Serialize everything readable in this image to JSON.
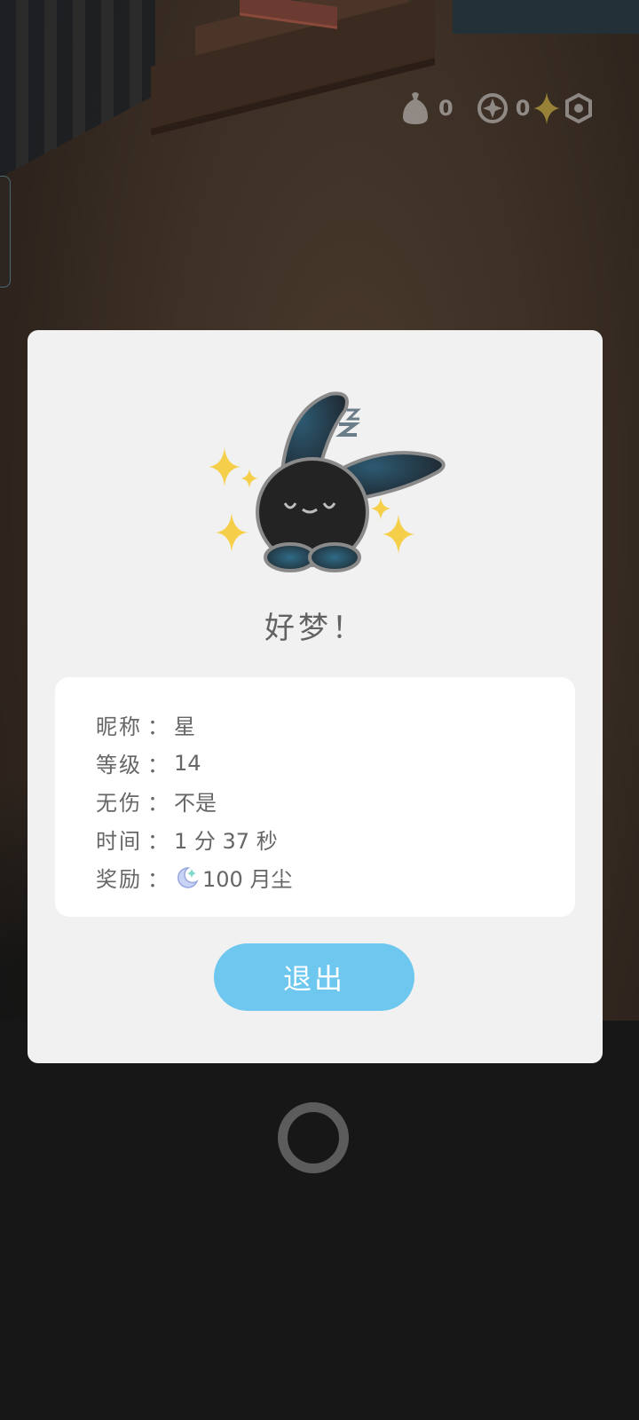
{
  "hud": {
    "bag_count": "0",
    "compass_count": "0",
    "icons": [
      "bag-icon",
      "compass-icon",
      "sparkle-icon",
      "hexagon-icon"
    ]
  },
  "dialog": {
    "title": "好梦！",
    "rows": [
      {
        "label": "昵称",
        "sep": "：",
        "value": "星"
      },
      {
        "label": "等级",
        "sep": "：",
        "value": "14"
      },
      {
        "label": "无伤",
        "sep": "：",
        "value": "不是"
      },
      {
        "label": "时间",
        "sep": "：",
        "value": "1 分 37 秒"
      },
      {
        "label": "奖励",
        "sep": "：",
        "value": "100 月尘",
        "icon": "moon-dust-icon"
      }
    ],
    "exit_label": "退出"
  },
  "colors": {
    "button": "#6dc7ef",
    "modal_bg": "#f1f1f1",
    "card_bg": "#ffffff",
    "text": "#666666"
  }
}
